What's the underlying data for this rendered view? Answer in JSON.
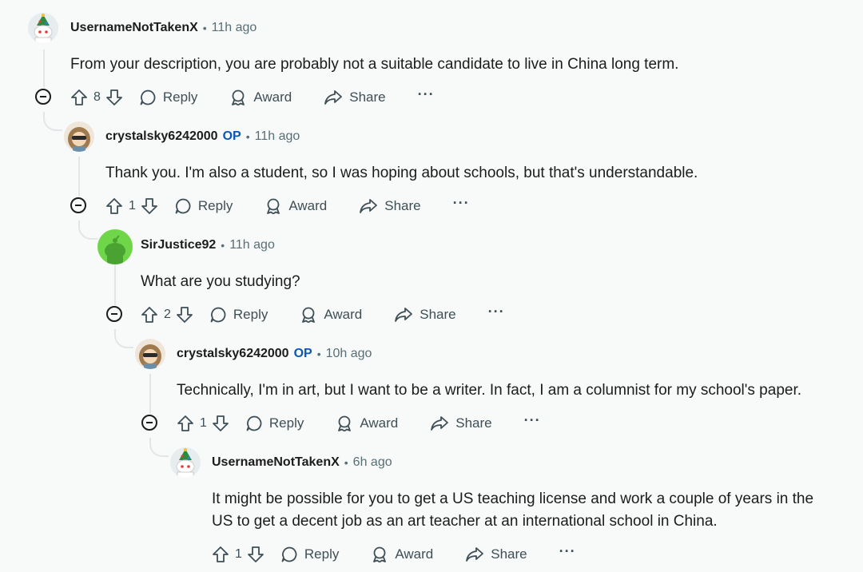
{
  "comments": [
    {
      "username": "UsernameNotTakenX",
      "op": "",
      "time": "11h ago",
      "text": "From your description, you are probably not a suitable candidate to live in China long term.",
      "votes": "8",
      "reply": "Reply",
      "award": "Award",
      "share": "Share",
      "more": "···"
    },
    {
      "username": "crystalsky6242000",
      "op": "OP",
      "time": "11h ago",
      "text": "Thank you. I'm also a student, so I was hoping about schools, but that's understandable.",
      "votes": "1",
      "reply": "Reply",
      "award": "Award",
      "share": "Share",
      "more": "···"
    },
    {
      "username": "SirJustice92",
      "op": "",
      "time": "11h ago",
      "text": "What are you studying?",
      "votes": "2",
      "reply": "Reply",
      "award": "Award",
      "share": "Share",
      "more": "···"
    },
    {
      "username": "crystalsky6242000",
      "op": "OP",
      "time": "10h ago",
      "text": "Technically, I'm in art, but I want to be a writer. In fact, I am a columnist for my school's paper.",
      "votes": "1",
      "reply": "Reply",
      "award": "Award",
      "share": "Share",
      "more": "···"
    },
    {
      "username": "UsernameNotTakenX",
      "op": "",
      "time": "6h ago",
      "text_line1": "It might be possible for you to get a US teaching license and work a couple of years in the",
      "text_line2": "US to get a decent job as an art teacher at an international school in China.",
      "votes": "1",
      "reply": "Reply",
      "award": "Award",
      "share": "Share",
      "more": "···"
    }
  ],
  "colors": {
    "op": "#0a57b8",
    "meta": "#576f76",
    "action": "#3e4f56",
    "thread": "#e3e6e8",
    "background": "#f8f9f9"
  }
}
